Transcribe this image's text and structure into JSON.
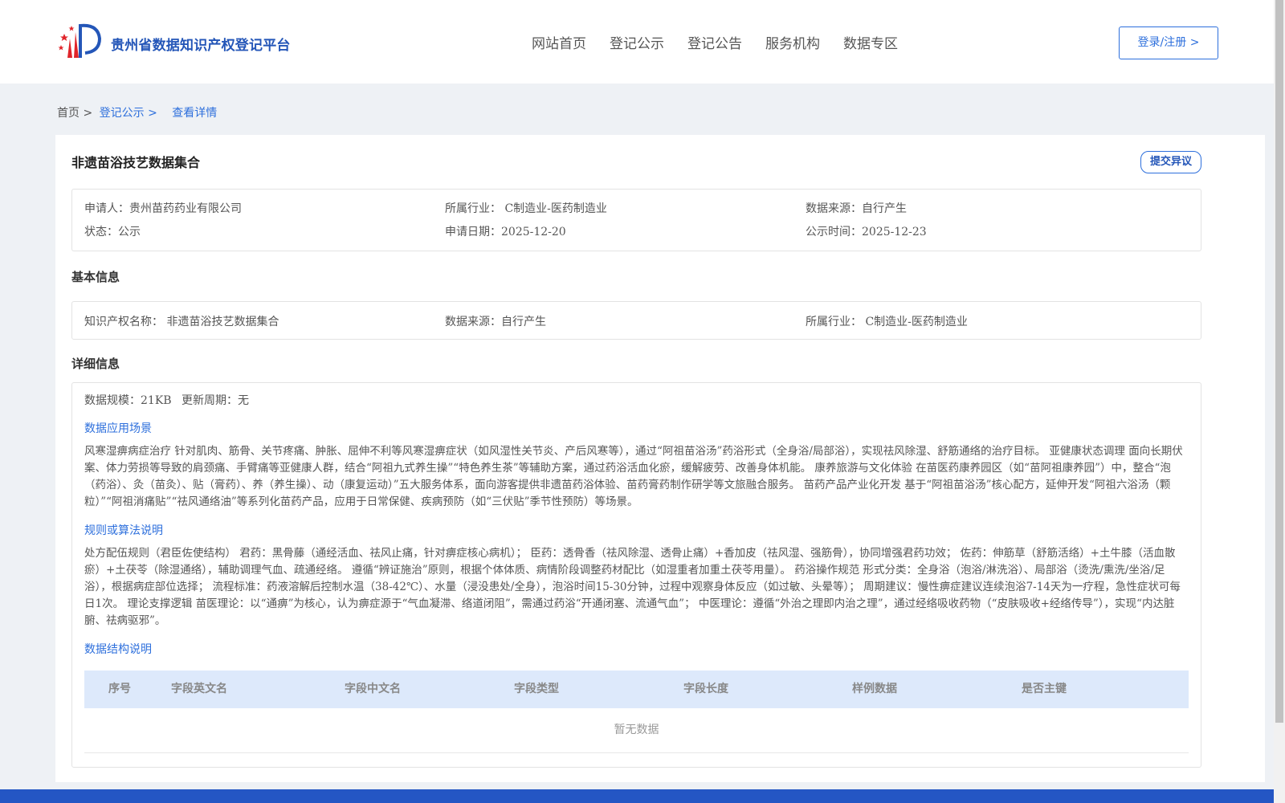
{
  "header": {
    "site_title": "贵州省数据知识产权登记平台",
    "nav": [
      "网站首页",
      "登记公示",
      "登记公告",
      "服务机构",
      "数据专区"
    ],
    "login_label": "登录/注册 >"
  },
  "breadcrumb": {
    "home": "首页 >",
    "parent": "登记公示 >",
    "current": "查看详情"
  },
  "record": {
    "title": "非遗苗浴技艺数据集合",
    "objection_label": "提交异议",
    "summary": {
      "applicant": "申请人：贵州苗药药业有限公司",
      "industry": "所属行业： C制造业-医药制造业",
      "source": "数据来源：自行产生",
      "status": "状态：公示",
      "apply_date": "申请日期：2025-12-20",
      "publish_date": "公示时间：2025-12-23"
    }
  },
  "basic_info": {
    "title": "基本信息",
    "ip_name": "知识产权名称： 非遗苗浴技艺数据集合",
    "source": "数据来源：自行产生",
    "industry": "所属行业： C制造业-医药制造业"
  },
  "detail_info": {
    "title": "详细信息",
    "scale": "数据规模：21KB",
    "update_cycle": "更新周期：无",
    "scenario_title": "数据应用场景",
    "scenario_text": "风寒湿痹病症治疗 针对肌肉、筋骨、关节疼痛、肿胀、屈伸不利等风寒湿痹症状（如风湿性关节炎、产后风寒等），通过“阿祖苗浴汤”药浴形式（全身浴/局部浴），实现祛风除湿、舒筋通络的治疗目标。 亚健康状态调理 面向长期伏案、体力劳损等导致的肩颈痛、手臂痛等亚健康人群，结合“阿祖九式养生操”“特色养生茶”等辅助方案，通过药浴活血化瘀，缓解疲劳、改善身体机能。 康养旅游与文化体验 在苗医药康养园区（如“苗阿祖康养园”）中，整合“泡（药浴）、灸（苗灸）、贴（膏药）、养（养生操）、动（康复运动）”五大服务体系，面向游客提供非遗苗药浴体验、苗药膏药制作研学等文旅融合服务。 苗药产品产业化开发 基于“阿祖苗浴汤”核心配方，延伸开发“阿祖六浴汤（颗粒）”“阿祖消痛贴”“祛风通络油”等系列化苗药产品，应用于日常保健、疾病预防（如“三伏贴”季节性预防）等场景。",
    "rules_title": "规则或算法说明",
    "rules_text": "处方配伍规则（君臣佐使结构） 君药：黑骨藤（通经活血、祛风止痛，针对痹症核心病机）； 臣药：透骨香（祛风除湿、透骨止痛）+香加皮（祛风湿、强筋骨），协同增强君药功效； 佐药：伸筋草（舒筋活络）+土牛膝（活血散瘀）+土茯苓（除湿通络），辅助调理气血、疏通经络。 遵循“辨证施治”原则，根据个体体质、病情阶段调整药材配比（如湿重者加重土茯苓用量）。 药浴操作规范 形式分类：全身浴（泡浴/淋洗浴）、局部浴（烫洗/熏洗/坐浴/足浴），根据病症部位选择； 流程标准：药液溶解后控制水温（38-42℃）、水量（浸没患处/全身），泡浴时间15-30分钟，过程中观察身体反应（如过敏、头晕等）； 周期建议：慢性痹症建议连续泡浴7-14天为一疗程，急性症状可每日1次。 理论支撑逻辑 苗医理论：以“通痹”为核心，认为痹症源于“气血凝滞、络道闭阻”，需通过药浴“开通闭塞、流通气血”； 中医理论：遵循“外治之理即内治之理”，通过经络吸收药物（“皮肤吸收+经络传导”），实现“内达脏腑、祛病驱邪”。",
    "structure_title": "数据结构说明",
    "table_headers": [
      "序号",
      "字段英文名",
      "字段中文名",
      "字段类型",
      "字段长度",
      "样例数据",
      "是否主键"
    ],
    "empty_text": "暂无数据"
  },
  "colors": {
    "brand_blue": "#2456b8",
    "link_blue": "#2d6fdc",
    "table_header_bg": "#dde9fb",
    "footer_bg": "#2456c4",
    "logo_red": "#e0242a"
  }
}
